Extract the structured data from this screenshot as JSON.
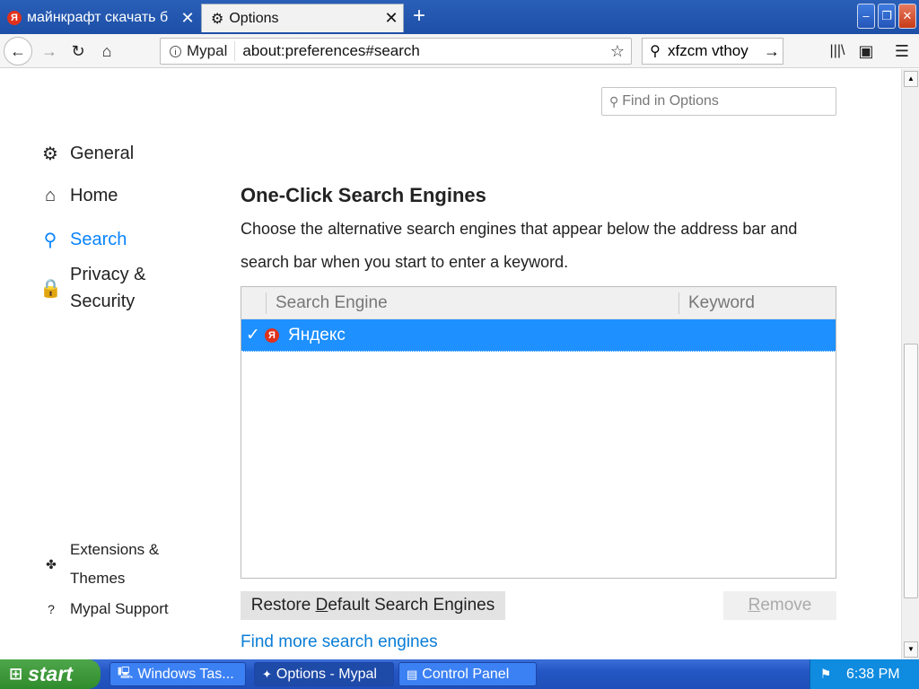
{
  "tabs": [
    {
      "label": "майнкрафт скачать б",
      "close": "✕"
    },
    {
      "label": "Options",
      "close": "✕"
    }
  ],
  "new_tab": "+",
  "window_controls": {
    "minimize": "–",
    "maximize": "❐",
    "close": "✕"
  },
  "nav": {
    "identity": "Mypal",
    "url": "about:preferences#search",
    "search_text": "xfzcm vthoy"
  },
  "find_placeholder": "Find in Options",
  "categories": [
    {
      "label": "General",
      "icon": "gear-icon"
    },
    {
      "label": "Home",
      "icon": "home-icon"
    },
    {
      "label": "Search",
      "icon": "search-icon"
    },
    {
      "label": "Privacy & Security",
      "icon": "lock-icon"
    }
  ],
  "footer_links": [
    {
      "label": "Extensions & Themes",
      "icon": "puzzle-icon"
    },
    {
      "label": "Mypal Support",
      "icon": "help-icon"
    }
  ],
  "section": {
    "heading": "One-Click Search Engines",
    "description": "Choose the alternative search engines that appear below the address bar and search bar when you start to enter a keyword."
  },
  "table": {
    "col_engine": "Search Engine",
    "col_keyword": "Keyword",
    "rows": [
      {
        "checked": "✓",
        "name": "Яндекс",
        "keyword": ""
      }
    ]
  },
  "buttons": {
    "restore_pre": "Restore ",
    "restore_accel": "D",
    "restore_post": "efault Search Engines",
    "remove_accel": "R",
    "remove_post": "emove"
  },
  "more_link": "Find more search engines",
  "taskbar": {
    "start": "start",
    "tasks": [
      "Windows Tas...",
      "Options - Mypal",
      "Control Panel"
    ],
    "clock": "6:38 PM"
  }
}
